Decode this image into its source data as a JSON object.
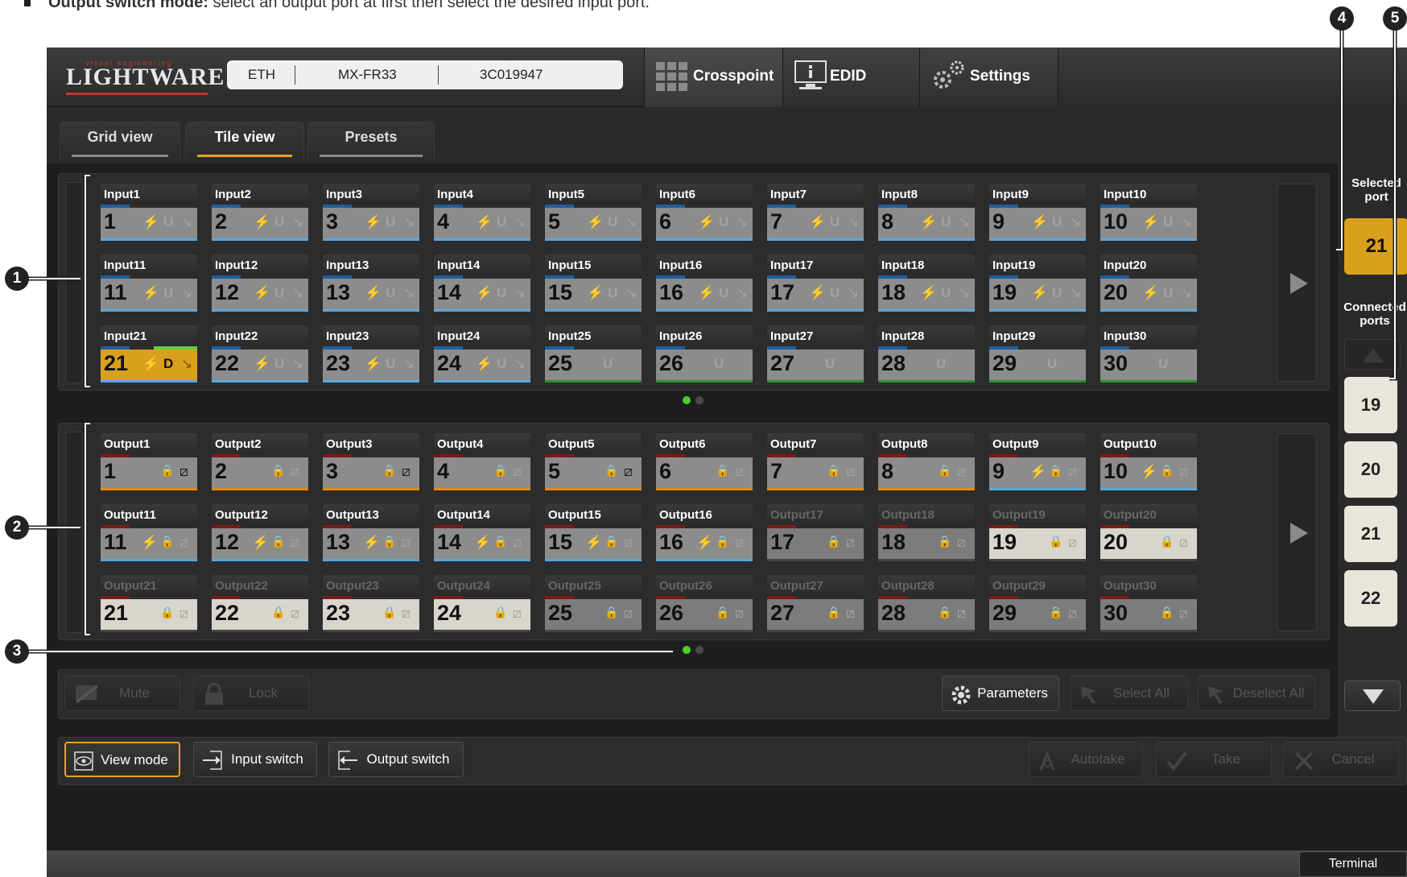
{
  "doc": {
    "bold": "Output switch mode:",
    "text": " select an output port at first then select the desired input port."
  },
  "callouts": [
    "1",
    "2",
    "3",
    "4",
    "5"
  ],
  "header": {
    "logo_tag": "visual engineering",
    "logo_word": "LIGHTWARE",
    "device": {
      "iface": "ETH",
      "model": "MX-FR33",
      "serial": "3C019947"
    },
    "tabs": [
      {
        "label": "Crosspoint",
        "icon": "grid-icon"
      },
      {
        "label": "EDID",
        "icon": "monitor-icon"
      },
      {
        "label": "Settings",
        "icon": "gears-icon"
      }
    ]
  },
  "subtabs": [
    "Grid view",
    "Tile view",
    "Presets"
  ],
  "inputs": [
    {
      "name": "Input1",
      "n": "1",
      "u": "U"
    },
    {
      "name": "Input2",
      "n": "2",
      "u": "U"
    },
    {
      "name": "Input3",
      "n": "3",
      "u": "U"
    },
    {
      "name": "Input4",
      "n": "4",
      "u": "U"
    },
    {
      "name": "Input5",
      "n": "5",
      "u": "U"
    },
    {
      "name": "Input6",
      "n": "6",
      "u": "U"
    },
    {
      "name": "Input7",
      "n": "7",
      "u": "U"
    },
    {
      "name": "Input8",
      "n": "8",
      "u": "U"
    },
    {
      "name": "Input9",
      "n": "9",
      "u": "U"
    },
    {
      "name": "Input10",
      "n": "10",
      "u": "U"
    },
    {
      "name": "Input11",
      "n": "11",
      "u": "U"
    },
    {
      "name": "Input12",
      "n": "12",
      "u": "U"
    },
    {
      "name": "Input13",
      "n": "13",
      "u": "U"
    },
    {
      "name": "Input14",
      "n": "14",
      "u": "U"
    },
    {
      "name": "Input15",
      "n": "15",
      "u": "U"
    },
    {
      "name": "Input16",
      "n": "16",
      "u": "U"
    },
    {
      "name": "Input17",
      "n": "17",
      "u": "U"
    },
    {
      "name": "Input18",
      "n": "18",
      "u": "U"
    },
    {
      "name": "Input19",
      "n": "19",
      "u": "U"
    },
    {
      "name": "Input20",
      "n": "20",
      "u": "U"
    },
    {
      "name": "Input21",
      "n": "21",
      "u": "D"
    },
    {
      "name": "Input22",
      "n": "22",
      "u": "U"
    },
    {
      "name": "Input23",
      "n": "23",
      "u": "U"
    },
    {
      "name": "Input24",
      "n": "24",
      "u": "U"
    },
    {
      "name": "Input25",
      "n": "25",
      "u": "U"
    },
    {
      "name": "Input26",
      "n": "26",
      "u": "U"
    },
    {
      "name": "Input27",
      "n": "27",
      "u": "U"
    },
    {
      "name": "Input28",
      "n": "28",
      "u": "U"
    },
    {
      "name": "Input29",
      "n": "29",
      "u": "U"
    },
    {
      "name": "Input30",
      "n": "30",
      "u": "U"
    }
  ],
  "outputs": [
    {
      "name": "Output1",
      "n": "1"
    },
    {
      "name": "Output2",
      "n": "2"
    },
    {
      "name": "Output3",
      "n": "3"
    },
    {
      "name": "Output4",
      "n": "4"
    },
    {
      "name": "Output5",
      "n": "5"
    },
    {
      "name": "Output6",
      "n": "6"
    },
    {
      "name": "Output7",
      "n": "7"
    },
    {
      "name": "Output8",
      "n": "8"
    },
    {
      "name": "Output9",
      "n": "9"
    },
    {
      "name": "Output10",
      "n": "10"
    },
    {
      "name": "Output11",
      "n": "11"
    },
    {
      "name": "Output12",
      "n": "12"
    },
    {
      "name": "Output13",
      "n": "13"
    },
    {
      "name": "Output14",
      "n": "14"
    },
    {
      "name": "Output15",
      "n": "15"
    },
    {
      "name": "Output16",
      "n": "16"
    },
    {
      "name": "Output17",
      "n": "17"
    },
    {
      "name": "Output18",
      "n": "18"
    },
    {
      "name": "Output19",
      "n": "19"
    },
    {
      "name": "Output20",
      "n": "20"
    },
    {
      "name": "Output21",
      "n": "21"
    },
    {
      "name": "Output22",
      "n": "22"
    },
    {
      "name": "Output23",
      "n": "23"
    },
    {
      "name": "Output24",
      "n": "24"
    },
    {
      "name": "Output25",
      "n": "25"
    },
    {
      "name": "Output26",
      "n": "26"
    },
    {
      "name": "Output27",
      "n": "27"
    },
    {
      "name": "Output28",
      "n": "28"
    },
    {
      "name": "Output29",
      "n": "29"
    },
    {
      "name": "Output30",
      "n": "30"
    }
  ],
  "side": {
    "selected_label": "Selected port",
    "selected_value": "21",
    "connected_label": "Connected ports",
    "connected": [
      "19",
      "20",
      "21",
      "22"
    ]
  },
  "toolbar": {
    "mute": "Mute",
    "lock": "Lock",
    "parameters": "Parameters",
    "select_all": "Select All",
    "deselect_all": "Deselect All"
  },
  "modes": {
    "view": "View mode",
    "input": "Input switch",
    "output": "Output switch"
  },
  "actions": {
    "autotake": "Autotake",
    "take": "Take",
    "cancel": "Cancel"
  },
  "status": {
    "terminal": "Terminal"
  },
  "colors": {
    "accent": "#e8a317",
    "selected_tile": "#d9a01e",
    "active_dot": "#49d02c",
    "input_line": "#58a8e0",
    "output_line": "#e08a1a"
  }
}
